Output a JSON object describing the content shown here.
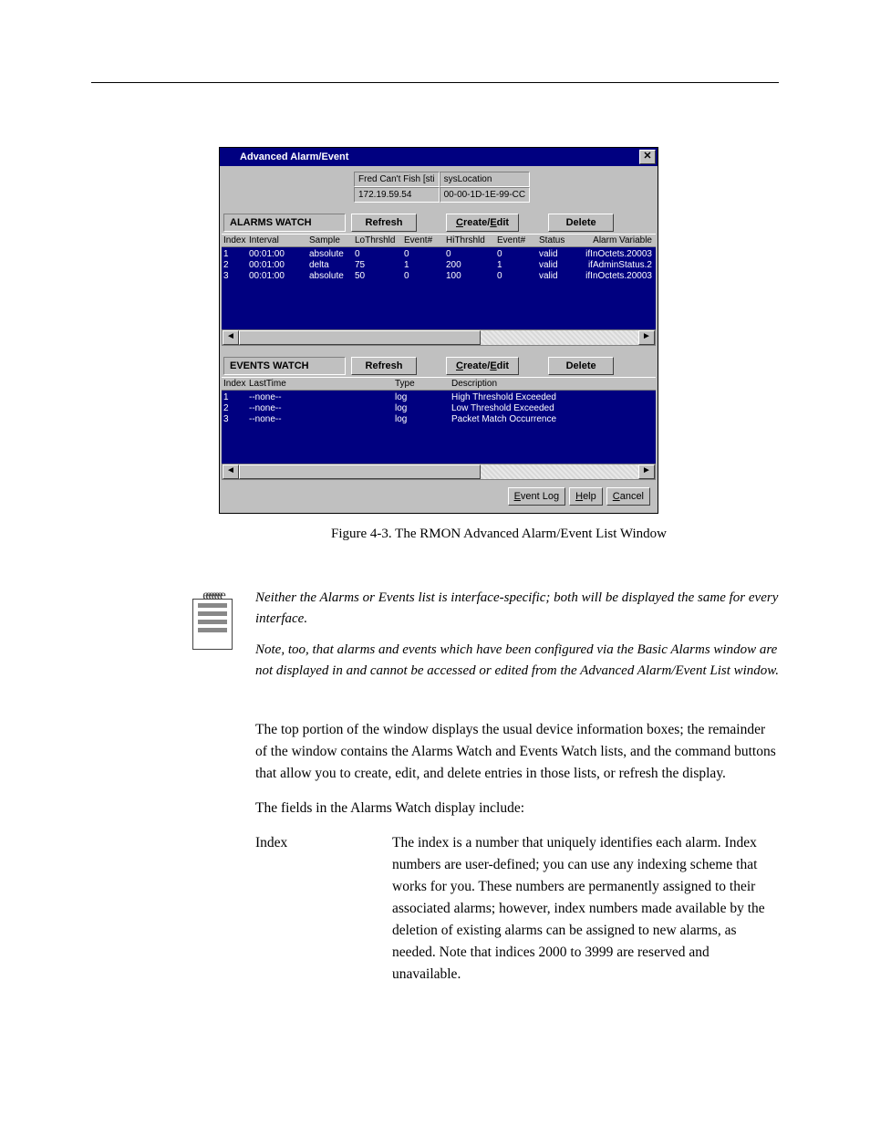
{
  "window": {
    "title": "Advanced Alarm/Event",
    "close_glyph": "✕",
    "device": {
      "top_left": "Fred Can't Fish [sti",
      "top_right": "sysLocation",
      "bot_left": "172.19.59.54",
      "bot_right": "00-00-1D-1E-99-CC"
    },
    "alarms": {
      "label": "ALARMS WATCH",
      "refresh": "Refresh",
      "create_edit_c": "C",
      "create_edit_r": "reate/",
      "create_edit_e": "E",
      "create_edit_d": "dit",
      "delete": "Delete",
      "headers": {
        "index": "Index",
        "interval": "Interval",
        "sample": "Sample",
        "lothrsh": "LoThrshld",
        "event1": "Event#",
        "hithrsh": "HiThrshld",
        "event2": "Event#",
        "status": "Status",
        "variable": "Alarm Variable"
      },
      "rows": [
        {
          "idx": "1",
          "interval": "00:01:00",
          "sample": "absolute",
          "lo": "0",
          "ev1": "0",
          "hi": "0",
          "ev2": "0",
          "status": "valid",
          "var": "ifInOctets.20003"
        },
        {
          "idx": "2",
          "interval": "00:01:00",
          "sample": "delta",
          "lo": "75",
          "ev1": "1",
          "hi": "200",
          "ev2": "1",
          "status": "valid",
          "var": "ifAdminStatus.2"
        },
        {
          "idx": "3",
          "interval": "00:01:00",
          "sample": "absolute",
          "lo": "50",
          "ev1": "0",
          "hi": "100",
          "ev2": "0",
          "status": "valid",
          "var": "ifInOctets.20003"
        }
      ]
    },
    "events": {
      "label": "EVENTS WATCH",
      "refresh": "Refresh",
      "create_edit_c": "C",
      "create_edit_r": "reate/",
      "create_edit_e": "E",
      "create_edit_d": "dit",
      "delete": "Delete",
      "headers": {
        "index": "Index",
        "lasttime": "LastTime",
        "type": "Type",
        "description": "Description"
      },
      "rows": [
        {
          "idx": "1",
          "last": "--none--",
          "type": "log",
          "desc": "High Threshold Exceeded"
        },
        {
          "idx": "2",
          "last": "--none--",
          "type": "log",
          "desc": "Low Threshold Exceeded"
        },
        {
          "idx": "3",
          "last": "--none--",
          "type": "log",
          "desc": "Packet Match Occurrence"
        }
      ]
    },
    "footer": {
      "eventlog_e": "E",
      "eventlog_r": "vent Log",
      "help_h": "H",
      "help_r": "elp",
      "cancel_c": "C",
      "cancel_r": "ancel"
    },
    "scroll": {
      "left": "◄",
      "right": "►"
    }
  },
  "caption": "Figure 4-3. The RMON Advanced Alarm/Event List Window",
  "note": {
    "p1": "Neither the Alarms or Events list is interface-specific; both will be displayed the same for every interface.",
    "p2": "Note, too, that alarms and events which have been configured via the Basic Alarms window are not displayed in and cannot be accessed or edited from the Advanced Alarm/Event List window."
  },
  "body": {
    "p1": "The top portion of the window displays the usual device information boxes; the remainder of the window contains the Alarms Watch and Events Watch lists, and the command buttons that allow you to create, edit, and delete entries in those lists, or refresh the display.",
    "p2": "The fields in the Alarms Watch display include:",
    "def_term": "Index",
    "def_desc": "The index is a number that uniquely identifies each alarm. Index numbers are user-defined; you can use any indexing scheme that works for you. These numbers are permanently assigned to their associated alarms; however, index numbers made available by the deletion of existing alarms can be assigned to new alarms, as needed. Note that indices 2000 to 3999 are reserved and unavailable."
  }
}
